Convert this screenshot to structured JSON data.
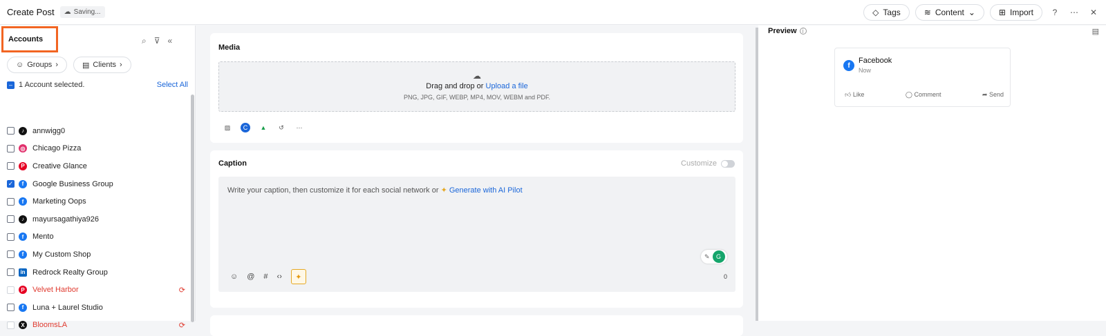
{
  "header": {
    "title": "Create Post",
    "saving_status": "Saving...",
    "tags_label": "Tags",
    "content_label": "Content",
    "import_label": "Import"
  },
  "sidebar": {
    "title": "Accounts",
    "groups_label": "Groups",
    "clients_label": "Clients",
    "selection_status": "1 Account selected.",
    "select_all_label": "Select All",
    "accounts": [
      {
        "name": "annwigg0",
        "network": "tiktok",
        "checked": false,
        "error": false
      },
      {
        "name": "Chicago Pizza",
        "network": "instagram",
        "checked": false,
        "error": false
      },
      {
        "name": "Creative Glance",
        "network": "pinterest",
        "checked": false,
        "error": false
      },
      {
        "name": "Google Business Group",
        "network": "facebook",
        "checked": true,
        "error": false
      },
      {
        "name": "Marketing Oops",
        "network": "facebook",
        "checked": false,
        "error": false
      },
      {
        "name": "mayursagathiya926",
        "network": "tiktok",
        "checked": false,
        "error": false
      },
      {
        "name": "Mento",
        "network": "facebook",
        "checked": false,
        "error": false
      },
      {
        "name": "My Custom Shop",
        "network": "facebook",
        "checked": false,
        "error": false
      },
      {
        "name": "Redrock Realty Group",
        "network": "linkedin",
        "checked": false,
        "error": false
      },
      {
        "name": "Velvet Harbor",
        "network": "pinterest",
        "checked": false,
        "error": true
      },
      {
        "name": "Luna + Laurel Studio",
        "network": "facebook",
        "checked": false,
        "error": false
      },
      {
        "name": "BloomsLA",
        "network": "x",
        "checked": false,
        "error": true
      }
    ]
  },
  "media": {
    "title": "Media",
    "drop_text": "Drag and drop or",
    "upload_link": "Upload a file",
    "formats": "PNG, JPG, GIF, WEBP, MP4, MOV, WEBM and PDF."
  },
  "caption": {
    "title": "Caption",
    "customize_label": "Customize",
    "placeholder": "Write your caption, then customize it for each social network or",
    "ai_link": "Generate with AI Pilot",
    "char_count": "0"
  },
  "preview": {
    "title": "Preview",
    "network_name": "Facebook",
    "time": "Now",
    "like_label": "Like",
    "comment_label": "Comment",
    "send_label": "Send"
  },
  "colors": {
    "accent": "#1a66d9",
    "highlight_border": "#f26522",
    "error": "#e03a2f"
  }
}
